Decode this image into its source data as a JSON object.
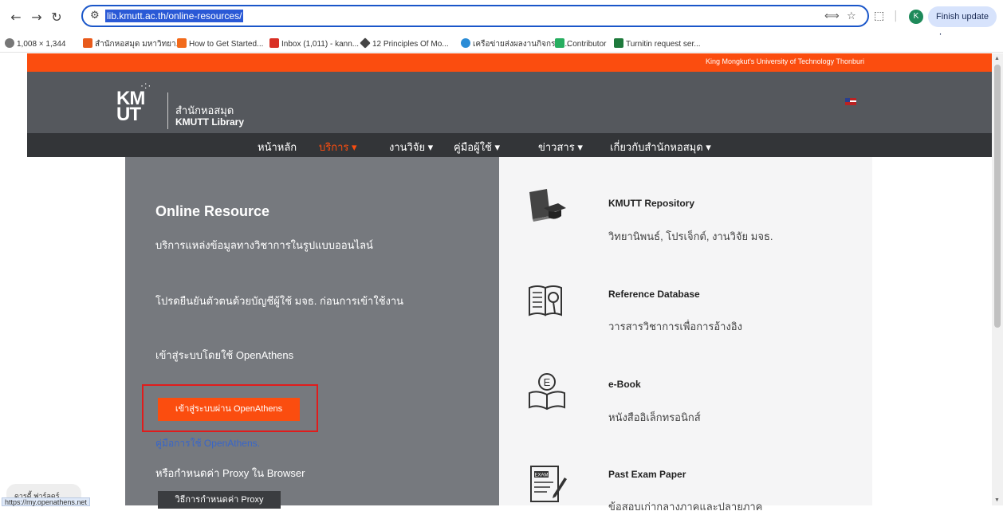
{
  "browser": {
    "url": "lib.kmutt.ac.th/online-resources/",
    "finish_update": "Finish update",
    "profile_initial": "K",
    "bookmarks": [
      {
        "label": "1,008 × 1,344",
        "color": "#777777"
      },
      {
        "label": "สำนักหอสมุด มหาวิทยา...",
        "color": "#e85a1b"
      },
      {
        "label": "How to Get Started...",
        "color": "#f26a1b"
      },
      {
        "label": "Inbox (1,011) - kann...",
        "color": "#d93025"
      },
      {
        "label": "12 Principles Of Mo...",
        "color": "#444444"
      },
      {
        "label": "เครือข่ายส่งผลงานกิจกรรม...",
        "color": "#2b8cd6"
      },
      {
        "label": "Contributor",
        "color": "#27ae60"
      },
      {
        "label": "Turnitin request ser...",
        "color": "#1e7a3c"
      }
    ],
    "status_url": "https://my.openathens.net",
    "floating_chip": "ดารดี้ ฟาร์ลดร์"
  },
  "site": {
    "university": "King Mongkut's University of Technology Thonburi",
    "logo_mark": "KM UT",
    "library_th": "สำนักหอสมุด",
    "library_en": "KMUTT Library",
    "menu": [
      {
        "label": "หน้าหลัก"
      },
      {
        "label": "บริการ ▾"
      },
      {
        "label": "งานวิจัย ▾"
      },
      {
        "label": "คู่มือผู้ใช้ ▾"
      },
      {
        "label": "ข่าวสาร ▾"
      },
      {
        "label": "เกี่ยวกับสำนักหอสมุด ▾"
      }
    ]
  },
  "left": {
    "title": "Online Resource",
    "subtitle": "บริการแหล่งข้อมูลทางวิชาการในรูปแบบออนไลน์",
    "auth_note": "โปรดยืนยันตัวตนด้วยบัญชีผู้ใช้ มจธ. ก่อนการเข้าใช้งาน",
    "login_note": "เข้าสู่ระบบโดยใช้ OpenAthens",
    "openathens_button": "เข้าสู่ระบบผ่าน OpenAthens",
    "manual_link": "คู่มือการใช้ OpenAthens.",
    "proxy_note": "หรือกำหนดค่า Proxy ใน Browser",
    "proxy_button": "วิธีการกำหนดค่า Proxy"
  },
  "resources": [
    {
      "title": "KMUTT Repository",
      "desc": "วิทยานิพนธ์, โปรเจ็กต์, งานวิจัย มจธ.",
      "icon": "graduation-book-icon"
    },
    {
      "title": "Reference Database",
      "desc": "วารสารวิชาการเพื่อการอ้างอิง",
      "icon": "search-book-icon"
    },
    {
      "title": "e-Book",
      "desc": "หนังสืออิเล็กทรอนิกส์",
      "icon": "ebook-icon"
    },
    {
      "title": "Past Exam Paper",
      "desc": "ข้อสอบเก่ากลางภาคและปลายภาค",
      "icon": "exam-icon"
    }
  ]
}
